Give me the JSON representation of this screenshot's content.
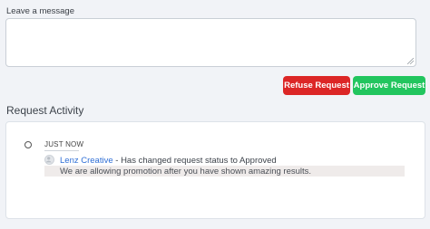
{
  "message": {
    "label": "Leave a message",
    "value": "",
    "placeholder": ""
  },
  "actions": {
    "refuse_label": "Refuse Request",
    "approve_label": "Approve Request",
    "refuse_color": "#dc2626",
    "approve_color": "#22c55e"
  },
  "activity": {
    "title": "Request Activity",
    "entries": [
      {
        "time": "JUST NOW",
        "author": "Lenz Creative",
        "action": " - Has changed request status to Approved",
        "comment": "We are allowing promotion after you have shown amazing results.",
        "author_color": "#2f6fd6"
      }
    ]
  }
}
